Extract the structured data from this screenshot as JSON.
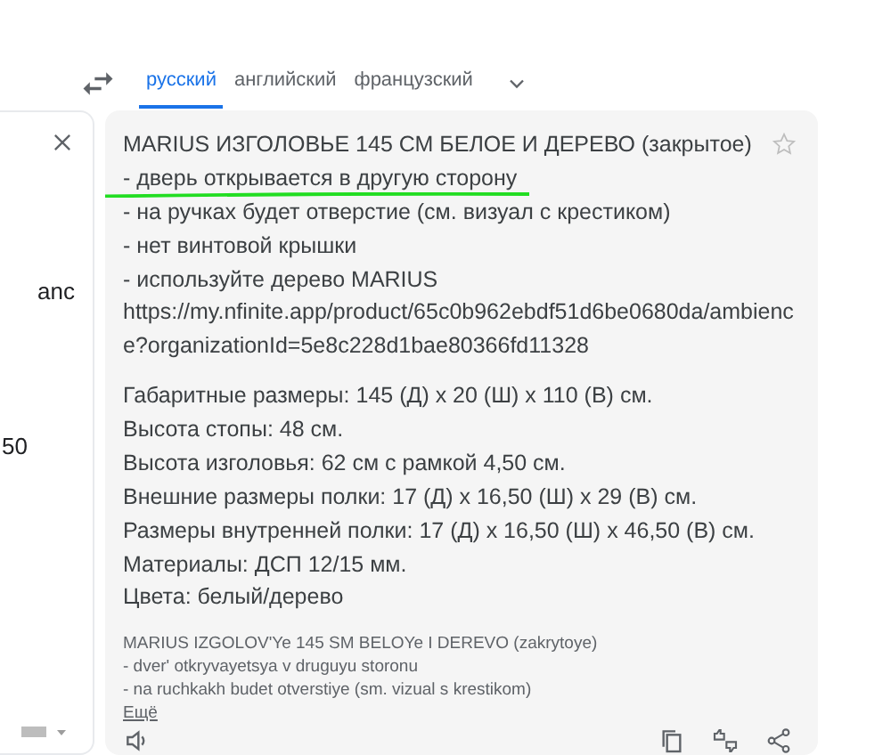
{
  "languages": [
    {
      "label": "русский",
      "selected": true
    },
    {
      "label": "английский",
      "selected": false
    },
    {
      "label": "французский",
      "selected": false
    }
  ],
  "source_panel": {
    "fragments": [
      "anc",
      "50"
    ]
  },
  "translation": {
    "blocks": [
      [
        "MARIUS ИЗГОЛОВЬЕ 145 СМ БЕЛОЕ И ДЕРЕВО (закрытое)",
        "- дверь открывается в другую сторону",
        "- на ручках будет отверстие (см. визуал с крестиком)",
        "- нет винтовой крышки",
        "- используйте дерево MARIUS",
        "https://my.nfinite.app/product/65c0b962ebdf51d6be0680da/ambienc",
        "e?organizationId=5e8c228d1bae80366fd11328"
      ],
      [
        "Габаритные размеры: 145 (Д) x 20 (Ш) x 110 (В) см.",
        "Высота стопы: 48 см.",
        "Высота изголовья: 62 см с рамкой 4,50 см.",
        "Внешние размеры полки: 17 (Д) x 16,50 (Ш) x 29 (В) см.",
        "Размеры внутренней полки: 17 (Д) x 16,50 (Ш) x 46,50 (В) см.",
        "Материалы: ДСП 12/15 мм.",
        "Цвета: белый/дерево"
      ]
    ],
    "starred": false,
    "transliteration": [
      "MARIUS IZGOLOV'Ye 145 SM BELOYe I DEREVO (zakrytoye)",
      "- dver' otkryvayetsya v druguyu storonu",
      "- na ruchkakh budet otverstiye (sm. vizual s krestikom)"
    ],
    "more_link": "Ещё"
  }
}
